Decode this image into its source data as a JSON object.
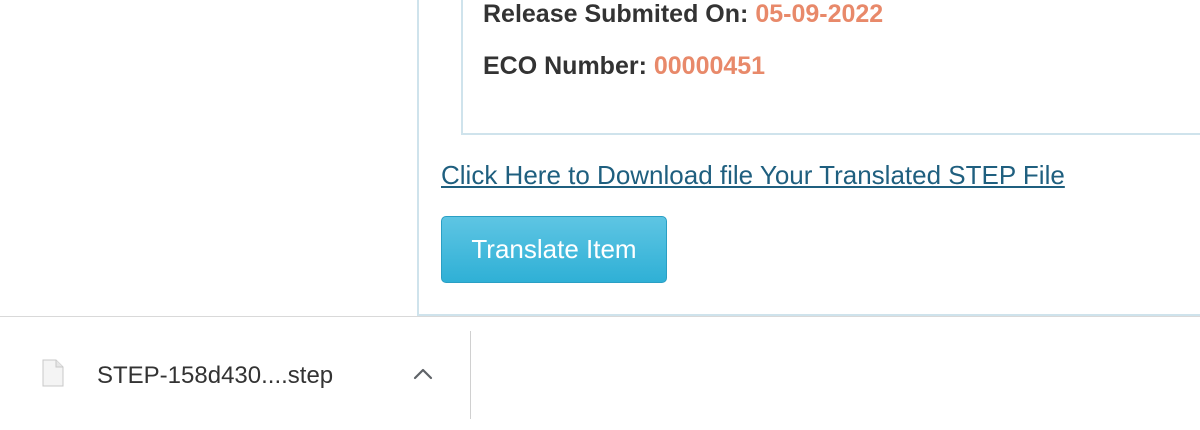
{
  "release": {
    "label": "Release Submited On:",
    "value": "05-09-2022"
  },
  "eco": {
    "label": "ECO Number:",
    "value": "00000451"
  },
  "download_link": "Click Here to Download file Your Translated STEP File",
  "translate_button": "Translate Item",
  "download_shelf": {
    "file_name": "STEP-158d430....step",
    "file_icon": "file-icon",
    "chevron_icon": "chevron-up-icon"
  },
  "colors": {
    "value_accent": "#e8896a",
    "link": "#1f5f7f",
    "button": "#2fb0d6",
    "panel_border": "#cfe3ec"
  }
}
